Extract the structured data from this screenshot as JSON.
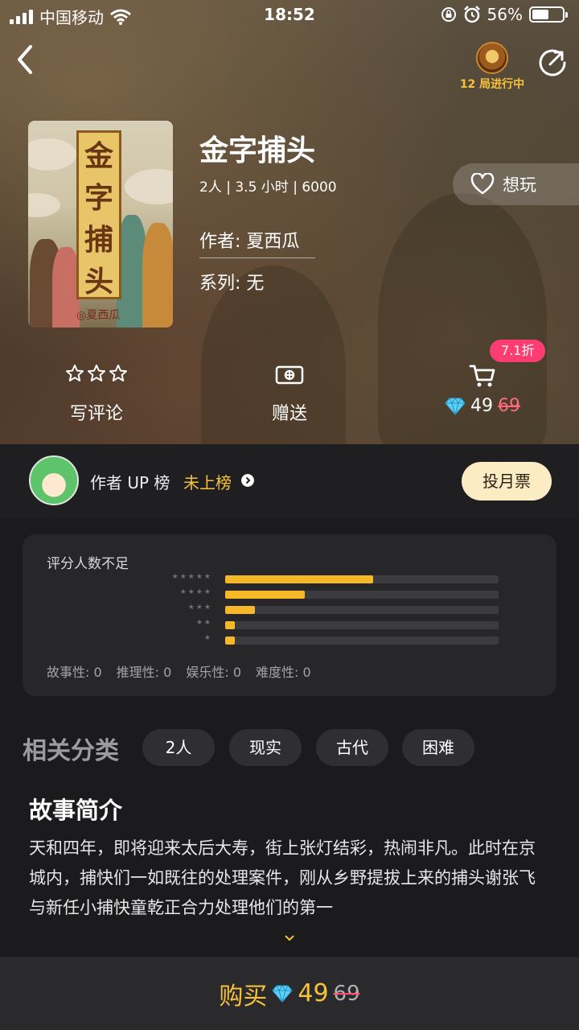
{
  "status_bar": {
    "carrier": "中国移动",
    "time": "18:52",
    "battery": "56%",
    "battery_level": 0.56
  },
  "header": {
    "live_badge": "12 局进行中"
  },
  "book": {
    "title": "金字捕头",
    "meta": "2人 | 3.5 小时 | 6000",
    "author": "作者: 夏西瓜",
    "series": "系列: 无",
    "cover_text": [
      "金",
      "字",
      "捕",
      "头"
    ],
    "cover_sign": "◎夏西瓜",
    "want_label": "想玩"
  },
  "actions": {
    "review_label": "写评论",
    "gift_label": "赠送",
    "discount": "7.1折",
    "price": "49",
    "original_price": "69"
  },
  "up_row": {
    "label": "作者 UP 榜",
    "rank": "未上榜",
    "vote_label": "投月票"
  },
  "rating": {
    "title": "评分人数不足",
    "bars": [
      {
        "stars": "★★★★★",
        "fraction": 0.54
      },
      {
        "stars": "★★★★",
        "fraction": 0.29
      },
      {
        "stars": "★★★",
        "fraction": 0.11
      },
      {
        "stars": "★★",
        "fraction": 0.035
      },
      {
        "stars": "★",
        "fraction": 0.035
      }
    ],
    "dims": [
      "故事性:  0",
      "推理性:  0",
      "娱乐性:  0",
      "难度性:  0"
    ]
  },
  "categories": {
    "label": "相关分类",
    "chips": [
      "2人",
      "现实",
      "古代",
      "困难"
    ]
  },
  "story": {
    "title": "故事简介",
    "text": "天和四年，即将迎来太后大寿，街上张灯结彩，热闹非凡。此时在京城内，捕快们一如既往的处理案件，刚从乡野提拔上来的捕头谢张飞与新任小捕快童乾正合力处理他们的第一"
  },
  "buy_bar": {
    "label": "购买",
    "price": "49",
    "original_price": "69"
  },
  "colors": {
    "accent": "#f6c23c",
    "discount": "#ff3d72",
    "bar_fill": "#f6b728"
  },
  "icons": [
    "back-icon",
    "share-icon",
    "heart-icon",
    "star-icon",
    "gift-icon",
    "cart-icon",
    "diamond-icon",
    "chevron-right-icon",
    "chevron-down-icon",
    "wifi-icon",
    "signal-icon",
    "alarm-icon",
    "lock-rotation-icon"
  ]
}
